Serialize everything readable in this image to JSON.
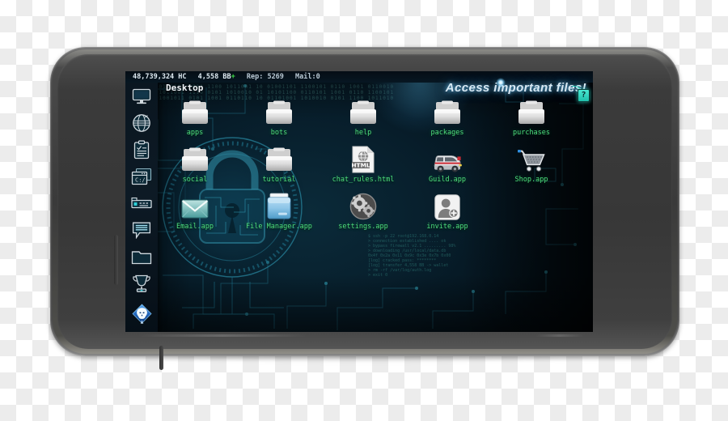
{
  "device": {
    "name": "smartphone-landscape",
    "body_color": "#3d3d3d",
    "screen_bg": "#04131c"
  },
  "game": {
    "theme_accent": "#4ee07f",
    "banner_accent": "#78d2ff",
    "wallpaper": "circuit-board-padlock-binary"
  },
  "statusbar": {
    "currency_hc": "48,739,324 HC",
    "currency_bb": "4,558 BB",
    "bb_plus": "+",
    "reputation": "Rep: 5269",
    "mail": "Mail:0"
  },
  "window": {
    "title": "Desktop",
    "banner": "Access important files!",
    "help_label": "?"
  },
  "sidebar": {
    "items": [
      {
        "label": "Desktop",
        "icon": "monitor-icon"
      },
      {
        "label": "Internet",
        "icon": "globe-icon"
      },
      {
        "label": "Missions",
        "icon": "clipboard-icon"
      },
      {
        "label": "Terminal",
        "icon": "terminal-icon"
      },
      {
        "label": "Hardware",
        "icon": "server-rack-icon"
      },
      {
        "label": "Chat",
        "icon": "chat-bubble-icon"
      },
      {
        "label": "Files",
        "icon": "folder-icon"
      },
      {
        "label": "Ranking",
        "icon": "trophy-icon"
      }
    ],
    "logo": {
      "label": "Hacker Experience",
      "icon": "skull-diamond-logo"
    }
  },
  "desktop": {
    "rows": [
      [
        {
          "label": "apps",
          "icon": "folder-grey-icon"
        },
        {
          "label": "bots",
          "icon": "folder-grey-icon"
        },
        {
          "label": "help",
          "icon": "folder-grey-icon"
        },
        {
          "label": "packages",
          "icon": "folder-grey-icon"
        },
        {
          "label": "purchases",
          "icon": "folder-grey-icon"
        }
      ],
      [
        {
          "label": "social",
          "icon": "folder-grey-icon"
        },
        {
          "label": "tutorial",
          "icon": "folder-grey-icon"
        },
        {
          "label": "chat_rules.html",
          "icon": "html-document-icon"
        },
        {
          "label": "Guild.app",
          "icon": "van-icon"
        },
        {
          "label": "Shop.app",
          "icon": "shopping-cart-icon"
        }
      ],
      [
        {
          "label": "Email.app",
          "icon": "envelope-icon"
        },
        {
          "label": "File Manager.app",
          "icon": "folder-blue-icon"
        },
        {
          "label": "settings.app",
          "icon": "gears-icon"
        },
        {
          "label": "invite.app",
          "icon": "add-user-icon"
        }
      ]
    ]
  },
  "wallpaper_text": {
    "binary_rows": [
      "0110100101110010 1010 0110 1001110 01 10110010 0011010 1001 0110 1110010",
      "1001011100101101 0011 1100 1011001 10 01001101 1100101 0110 1001 0110010",
      "0101101001011001 1110 0101 1010010 01 10101100 0110101 1001 0110 1100101",
      "1100101101001011 0101 1001 0110110 10 01101001 1010010 0101 1100 1011010"
    ],
    "code_lines": [
      "$ ssh -p 22 root@192.168.0.14",
      "> connection established .... ok",
      "> bypass firewall v2.1 ......... 98%",
      "> downloading /usr/local/data.db",
      "0x4f 0x2a 0x11 0x9c 0x3e 0x7b 0x00",
      "[log] cracked pass: ********",
      "[log] transfer 4,558 BB -> wallet",
      "> rm -rf /var/log/auth.log",
      "> exit 0"
    ]
  }
}
